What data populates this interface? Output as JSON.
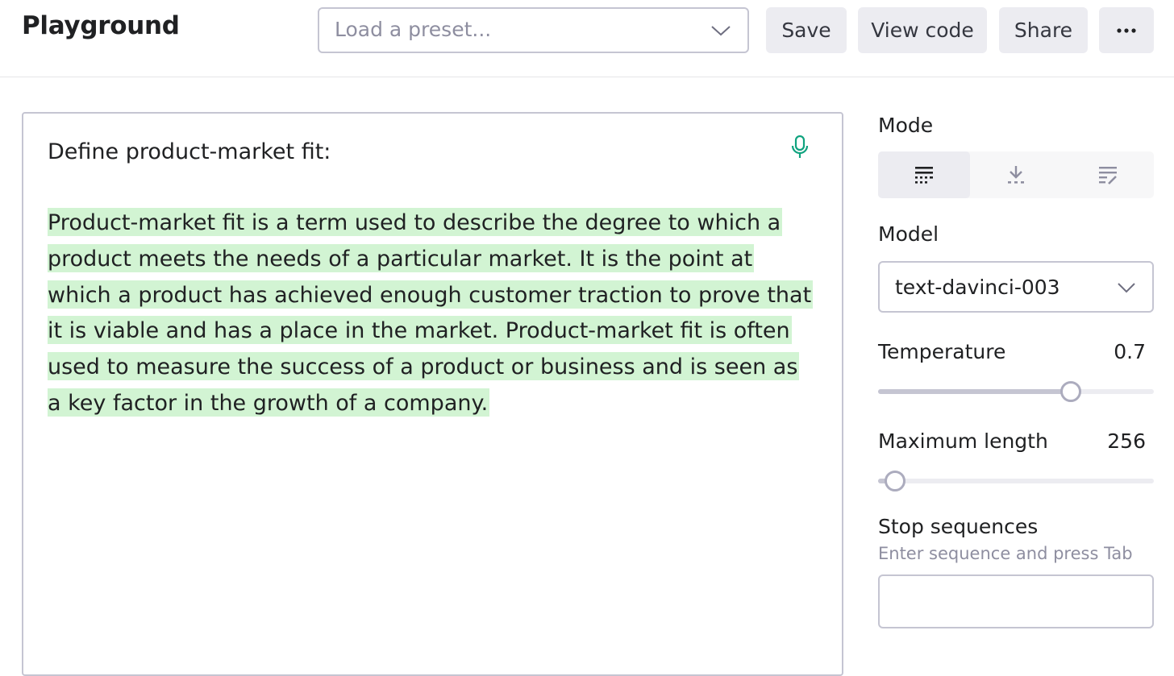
{
  "header": {
    "title": "Playground",
    "preset_placeholder": "Load a preset...",
    "save_label": "Save",
    "view_code_label": "View code",
    "share_label": "Share",
    "more_label": "···"
  },
  "editor": {
    "prompt": "Define product-market fit:",
    "completion_lines": [
      "Product-market fit is a term used to describe the degree to which a",
      "product meets the needs of a particular market. It is the point at",
      "which a product has achieved enough customer traction to prove that",
      " it is viable and has a place in the market. Product-market fit is often",
      "used to measure the success of a product or business and is seen as",
      "a key factor in the growth of a company."
    ],
    "highlight_color": "#d2f4d3",
    "mic_color": "#10a37f"
  },
  "sidebar": {
    "mode_label": "Mode",
    "modes": [
      {
        "icon": "complete-icon",
        "active": true
      },
      {
        "icon": "insert-icon",
        "active": false
      },
      {
        "icon": "edit-icon",
        "active": false
      }
    ],
    "model_label": "Model",
    "model_value": "text-davinci-003",
    "temperature_label": "Temperature",
    "temperature_value": "0.7",
    "temperature_fraction": 0.7,
    "max_length_label": "Maximum length",
    "max_length_value": "256",
    "max_length_fraction": 0.062,
    "stop_label": "Stop sequences",
    "stop_hint": "Enter sequence and press Tab",
    "stop_value": ""
  }
}
